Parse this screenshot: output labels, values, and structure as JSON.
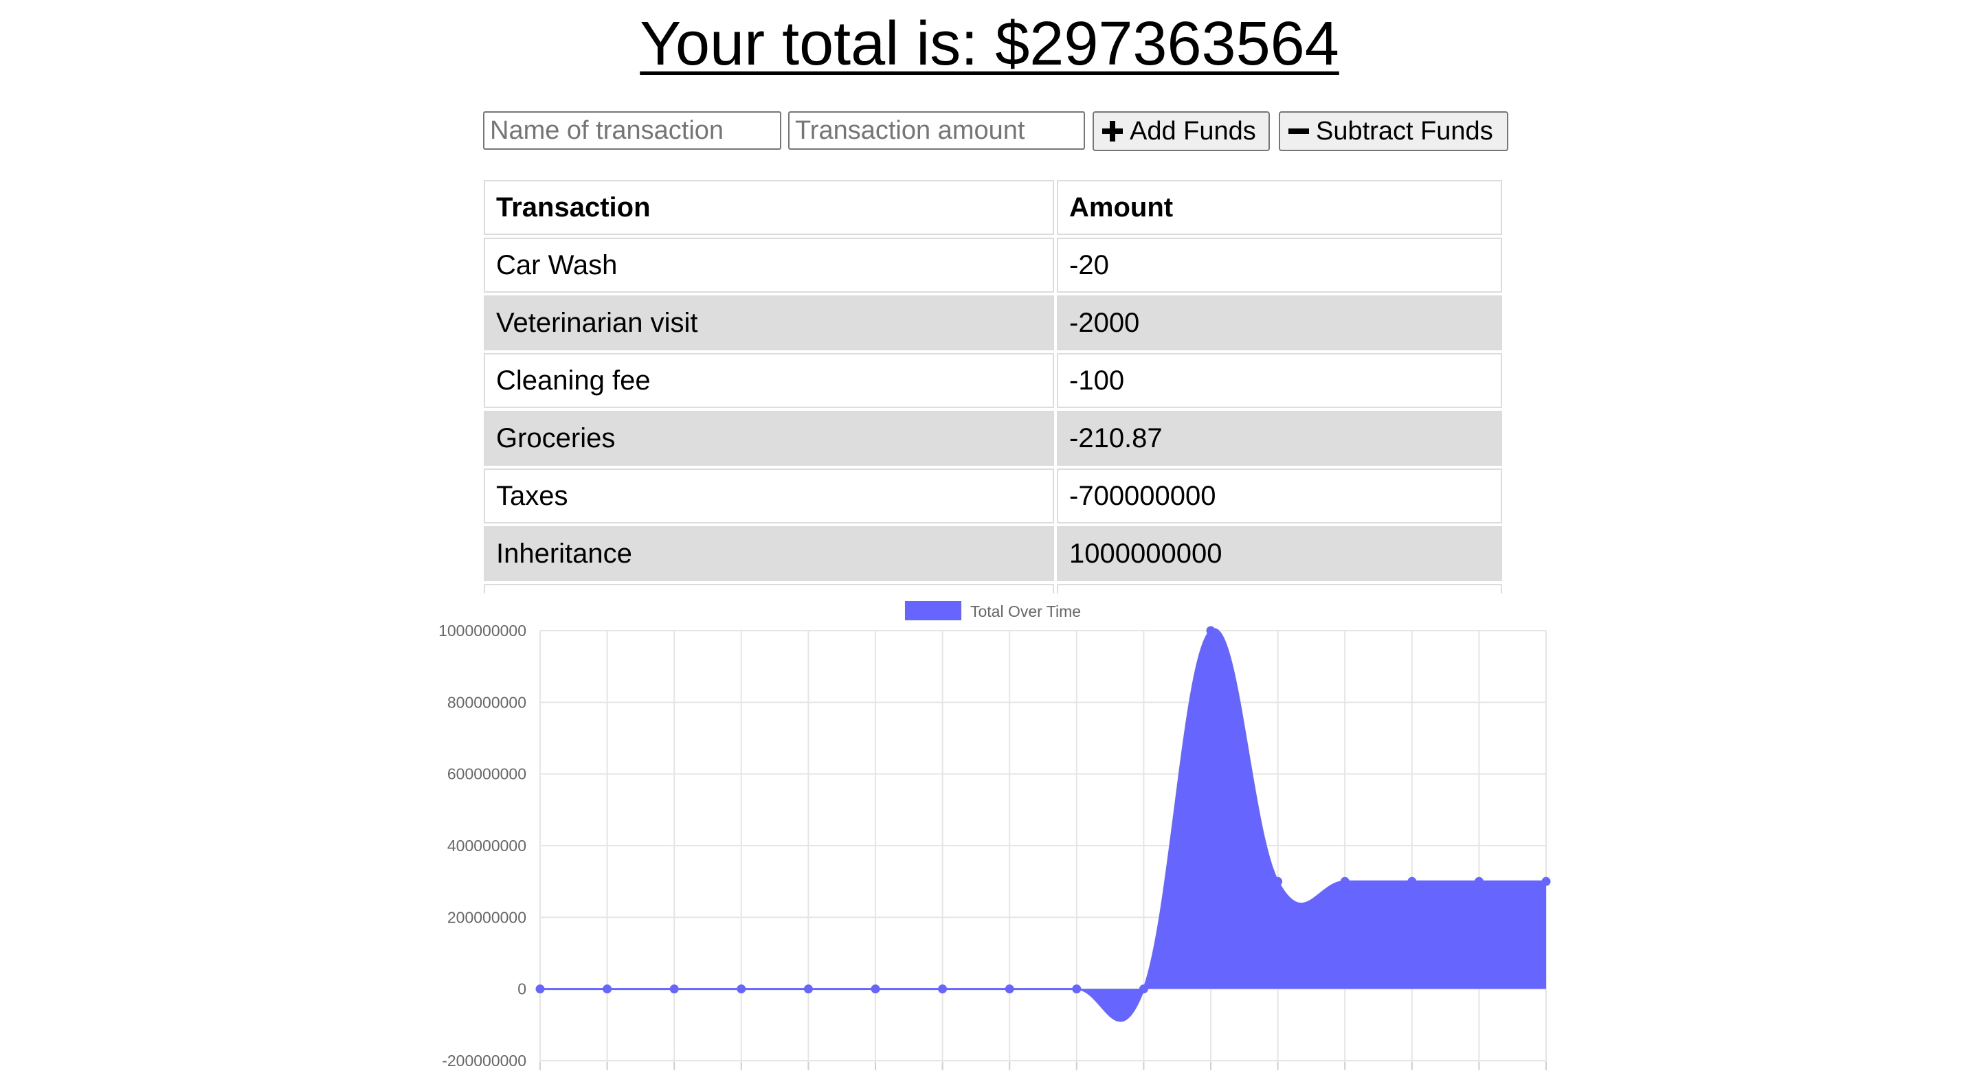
{
  "header": {
    "total_text": "Your total is: $297363564"
  },
  "form": {
    "name_placeholder": "Name of transaction",
    "amount_placeholder": "Transaction amount",
    "add_label": "Add Funds",
    "subtract_label": "Subtract Funds"
  },
  "table": {
    "headers": [
      "Transaction",
      "Amount"
    ],
    "rows": [
      {
        "name": "Car Wash",
        "amount": "-20"
      },
      {
        "name": "Veterinarian visit",
        "amount": "-2000"
      },
      {
        "name": "Cleaning fee",
        "amount": "-100"
      },
      {
        "name": "Groceries",
        "amount": "-210.87"
      },
      {
        "name": "Taxes",
        "amount": "-700000000"
      },
      {
        "name": "Inheritance",
        "amount": "1000000000"
      }
    ]
  },
  "colors": {
    "series_fill": "#6666ff",
    "series_line": "#6666ff",
    "grid": "#e5e5e5",
    "shaded_row": "#dddddd"
  },
  "chart_data": {
    "type": "area",
    "legend": {
      "position": "top",
      "label": "Total Over Time"
    },
    "ylim": [
      -200000000,
      1000000000
    ],
    "y_ticks": [
      1000000000,
      800000000,
      600000000,
      400000000,
      200000000,
      0,
      -200000000
    ],
    "grid": true,
    "series": [
      {
        "name": "Total Over Time",
        "values": [
          0,
          0,
          0,
          0,
          0,
          0,
          0,
          0,
          0,
          0,
          1000000000,
          300000000,
          300000000,
          300000000,
          300000000,
          300000000
        ]
      }
    ]
  }
}
